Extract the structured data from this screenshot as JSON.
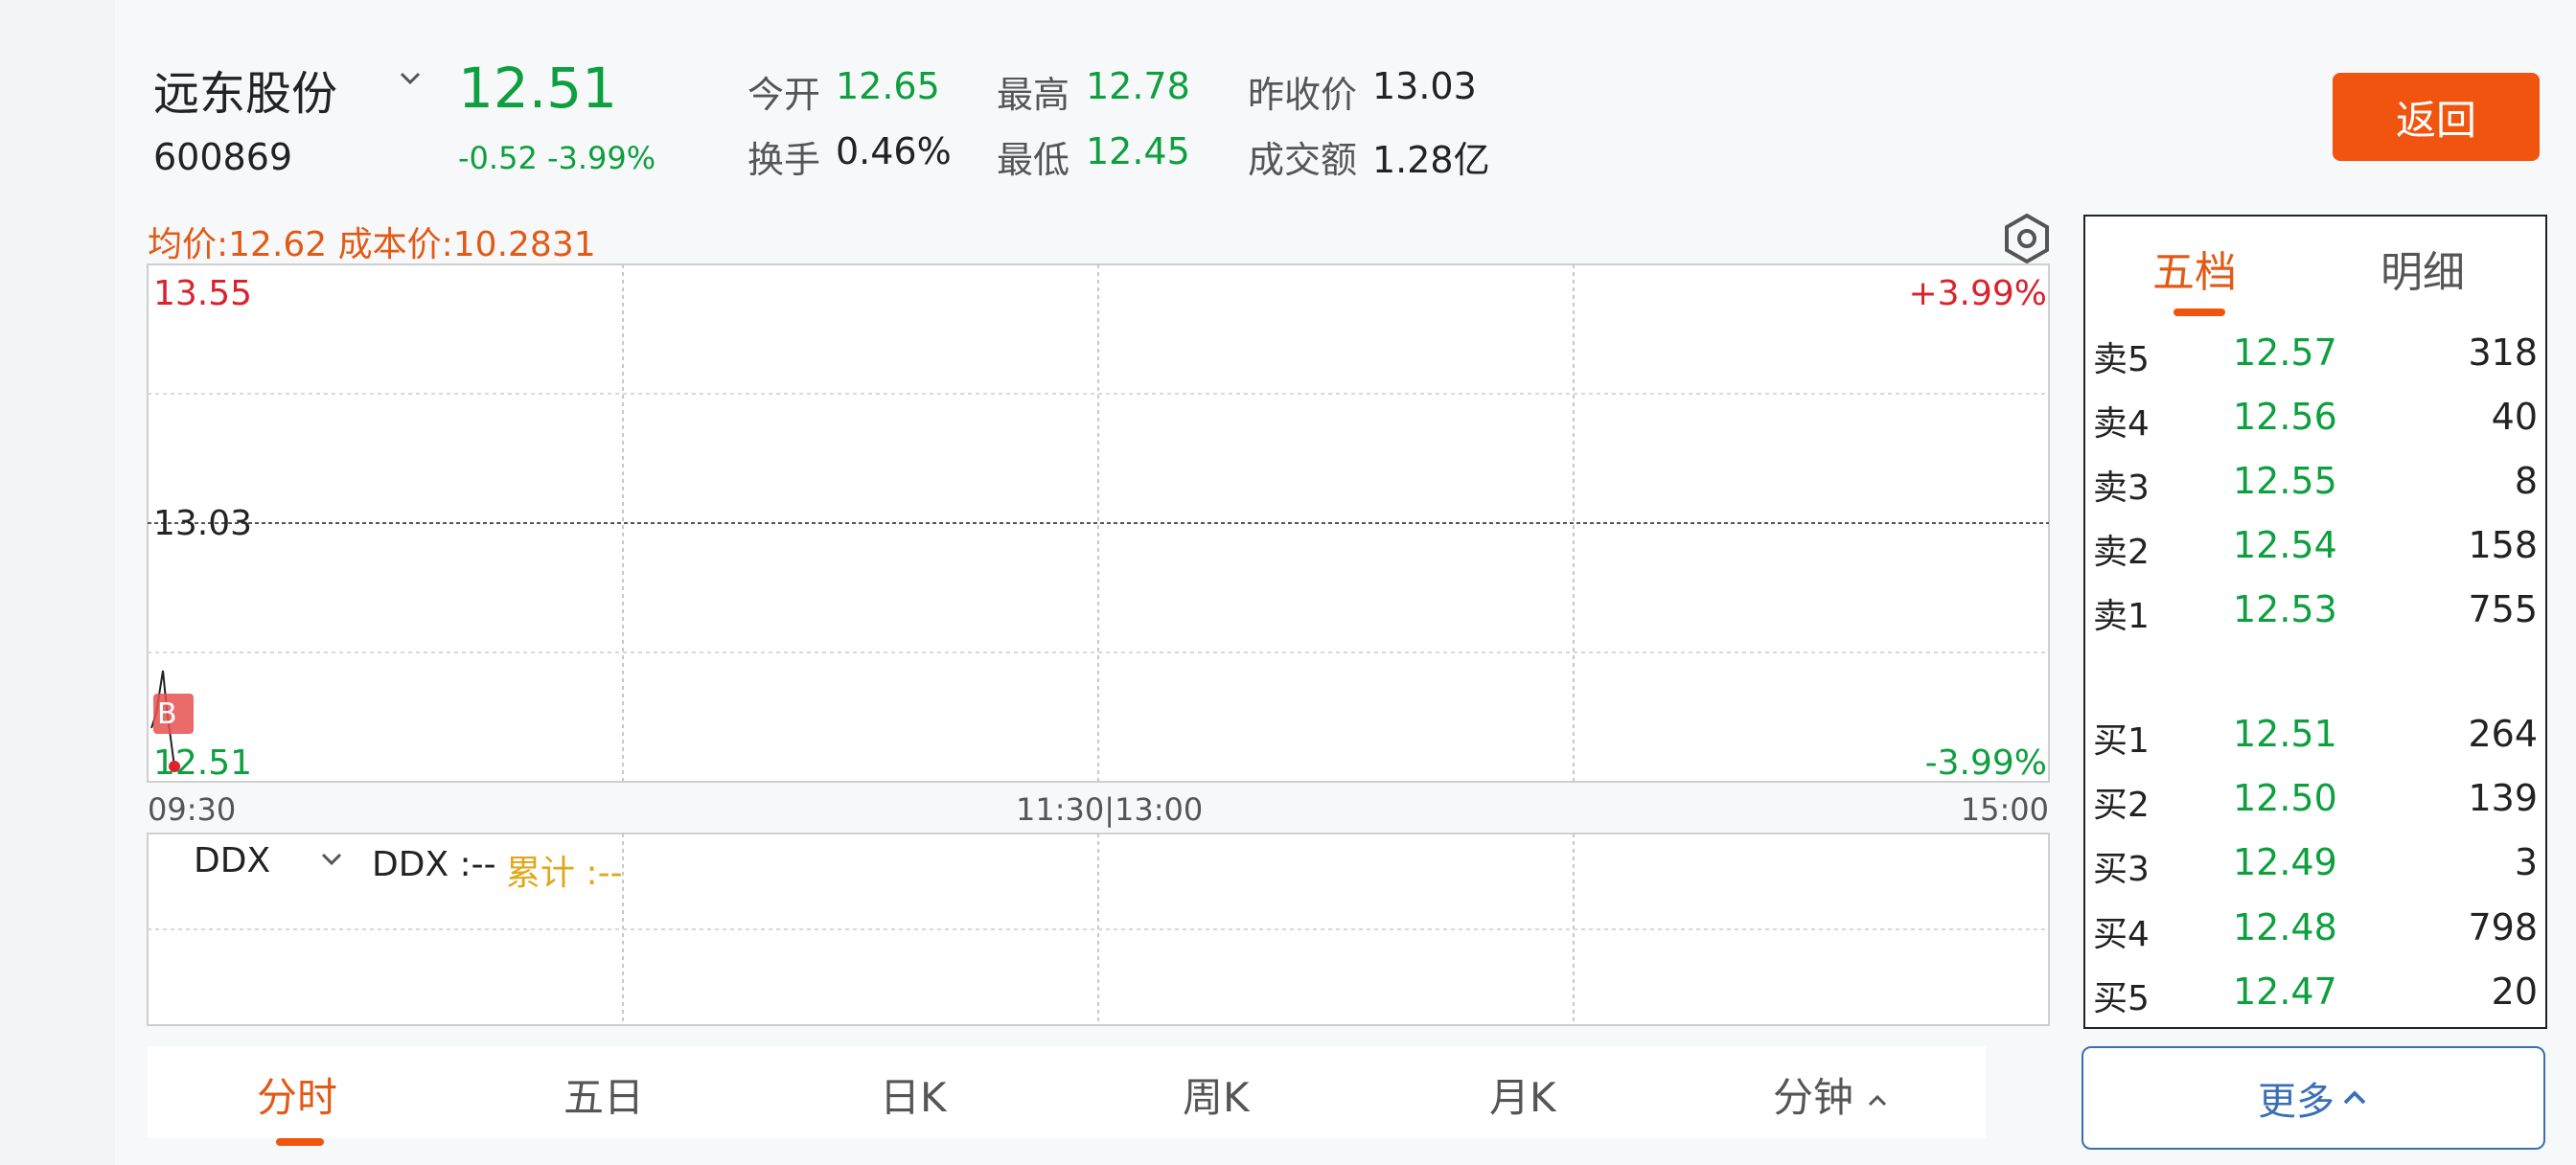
{
  "header": {
    "stock_name": "远东股份",
    "stock_code": "600869",
    "price": "12.51",
    "change": "-0.52 -3.99%",
    "stats": [
      {
        "label": "今开",
        "value": "12.65",
        "color": "green"
      },
      {
        "label": "最高",
        "value": "12.78",
        "color": "green"
      },
      {
        "label": "昨收价",
        "value": "13.03",
        "color": "dark"
      },
      {
        "label": "换手",
        "value": "0.46%",
        "color": "dark"
      },
      {
        "label": "最低",
        "value": "12.45",
        "color": "green"
      },
      {
        "label": "成交额",
        "value": "1.28亿",
        "color": "dark"
      }
    ],
    "back_label": "返回"
  },
  "chart": {
    "avg_cost": "均价:12.62 成本价:10.2831",
    "y_high": "13.55",
    "y_mid": "13.03",
    "y_low": "12.51",
    "pct_high": "+3.99%",
    "pct_low": "-3.99%",
    "time_start": "09:30",
    "time_mid": "11:30|13:00",
    "time_end": "15:00",
    "marker": "B"
  },
  "ddx": {
    "selector": "DDX",
    "value": "DDX :--",
    "cumulative": "累计 :--"
  },
  "tabs": [
    {
      "label": "分时",
      "active": true
    },
    {
      "label": "五日",
      "active": false
    },
    {
      "label": "日K",
      "active": false
    },
    {
      "label": "周K",
      "active": false
    },
    {
      "label": "月K",
      "active": false
    },
    {
      "label": "分钟",
      "active": false
    }
  ],
  "orderbook": {
    "tabs": [
      "五档",
      "明细"
    ],
    "sell": [
      {
        "label": "卖5",
        "price": "12.57",
        "volume": "318"
      },
      {
        "label": "卖4",
        "price": "12.56",
        "volume": "40"
      },
      {
        "label": "卖3",
        "price": "12.55",
        "volume": "8"
      },
      {
        "label": "卖2",
        "price": "12.54",
        "volume": "158"
      },
      {
        "label": "卖1",
        "price": "12.53",
        "volume": "755"
      }
    ],
    "buy": [
      {
        "label": "买1",
        "price": "12.51",
        "volume": "264"
      },
      {
        "label": "买2",
        "price": "12.50",
        "volume": "139"
      },
      {
        "label": "买3",
        "price": "12.49",
        "volume": "3"
      },
      {
        "label": "买4",
        "price": "12.48",
        "volume": "798"
      },
      {
        "label": "买5",
        "price": "12.47",
        "volume": "20"
      }
    ],
    "more_label": "更多"
  },
  "colors": {
    "up": "#d9232d",
    "down": "#0e9f3e",
    "accent": "#f0540e",
    "link": "#3a6fb8"
  }
}
